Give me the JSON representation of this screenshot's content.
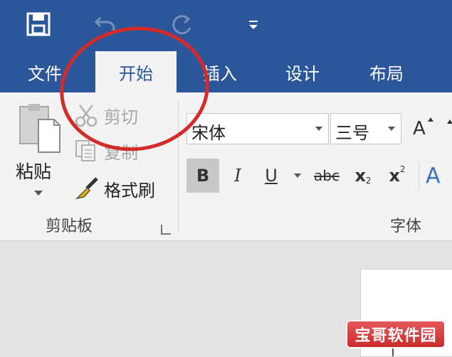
{
  "quick_access": {
    "save_icon": "save-icon",
    "undo_icon": "undo-icon",
    "redo_icon": "redo-icon",
    "customize_icon": "customize-qat-icon"
  },
  "tabs": [
    {
      "label": "文件"
    },
    {
      "label": "开始",
      "active": true
    },
    {
      "label": "插入"
    },
    {
      "label": "设计"
    },
    {
      "label": "布局"
    }
  ],
  "clipboard": {
    "paste_label": "粘贴",
    "cut_label": "剪切",
    "copy_label": "复制",
    "format_painter_label": "格式刷",
    "group_label": "剪贴板"
  },
  "font": {
    "font_name": "宋体",
    "font_size": "三号",
    "grow_label": "A",
    "bold_label": "B",
    "italic_label": "I",
    "underline_label": "U",
    "strike_label": "abc",
    "subscript_label": "x",
    "subscript_mark": "2",
    "superscript_label": "x",
    "superscript_mark": "2",
    "effects_label": "A",
    "group_label": "字体"
  },
  "colors": {
    "ribbon_blue": "#2b579a",
    "annotation_red": "#d42a2a"
  },
  "watermark": {
    "text": "宝哥软件园"
  }
}
